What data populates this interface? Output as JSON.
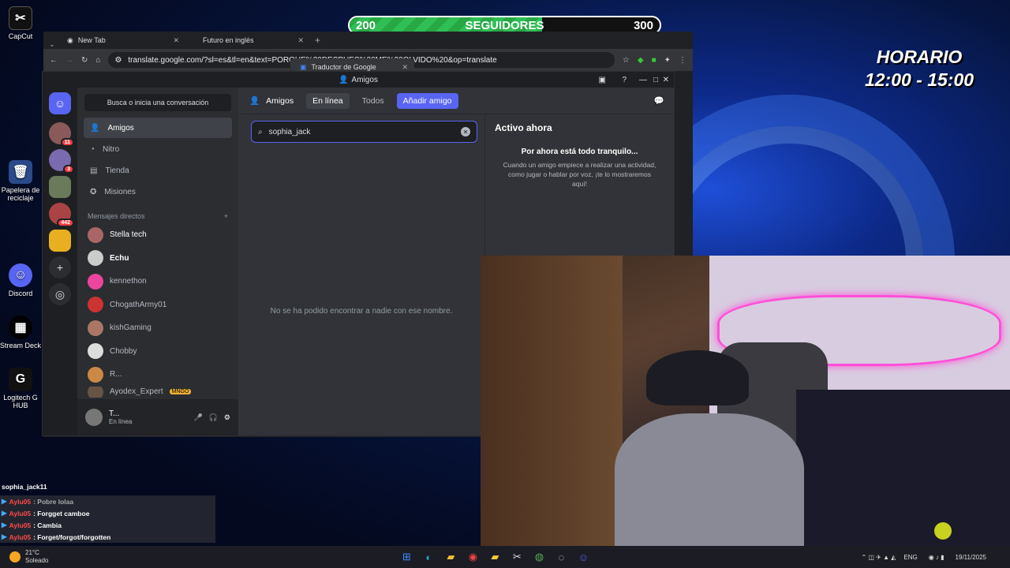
{
  "desktop": {
    "icons": [
      {
        "label": "CapCut",
        "glyph": "✂"
      },
      {
        "label": "Papelera de reciclaje",
        "glyph": "🗑"
      },
      {
        "label": "Discord",
        "glyph": "☺"
      },
      {
        "label": "Stream Deck",
        "glyph": "▦"
      },
      {
        "label": "Logitech G HUB",
        "glyph": "G"
      }
    ]
  },
  "overlay": {
    "followers_min": "200",
    "followers_label": "SEGUIDORES",
    "followers_max": "300",
    "follower_progress": 0.62,
    "horario_title": "HORARIO",
    "horario_time": "12:00 - 15:00"
  },
  "browser": {
    "tabs": [
      "New Tab",
      "Traductor de Google",
      "Futuro en inglés"
    ],
    "new_tab_glyph": "+",
    "url": "translate.google.com/?sl=es&tl=en&text=PORQUE%20DESPUES%20ME%20OLVIDO%20&op=translate"
  },
  "discord": {
    "window_title": "Amigos",
    "guild_badges": [
      "11",
      "3",
      "",
      "442"
    ],
    "search_placeholder": "Busca o inicia una conversación",
    "nav": [
      "Amigos",
      "Nitro",
      "Tienda",
      "Misiones"
    ],
    "dm_header": "Mensajes directos",
    "dms": [
      "Stella tech",
      "Echu",
      "kennethon",
      "ChogathArmy01",
      "kishGaming",
      "Chobby",
      "R...",
      "Ayodex_Expert"
    ],
    "dm_tag": "MNGO",
    "user": {
      "name": "T...",
      "status": "En línea"
    },
    "tabs": {
      "friends": "Amigos",
      "online": "En línea",
      "all": "Todos",
      "add": "Añadir amigo"
    },
    "search_value": "sophia_jack",
    "no_results": "No se ha podido encontrar a nadie con ese nombre.",
    "active_now": {
      "title": "Activo ahora",
      "subtitle": "Por ahora está todo tranquilo...",
      "body": "Cuando un amigo empiece a realizar una actividad, como jugar o hablar por voz, ¡te lo mostraremos aquí!"
    }
  },
  "chat": {
    "top_user": "sophia_jack11",
    "messages": [
      {
        "user": "Aylu05",
        "text": ": Pobre lolaa"
      },
      {
        "user": "Aylu05",
        "text": ": Forgget camboe"
      },
      {
        "user": "Aylu05",
        "text": ": Cambia"
      },
      {
        "user": "Aylu05",
        "text": ": Forget/forgot/forgotten"
      }
    ]
  },
  "taskbar": {
    "temp": "21°C",
    "weather": "Soleado",
    "lang": "ENG",
    "date": "19/11/2025"
  },
  "colors": {
    "accent": "#5865f2",
    "follower_green": "#28a745"
  }
}
